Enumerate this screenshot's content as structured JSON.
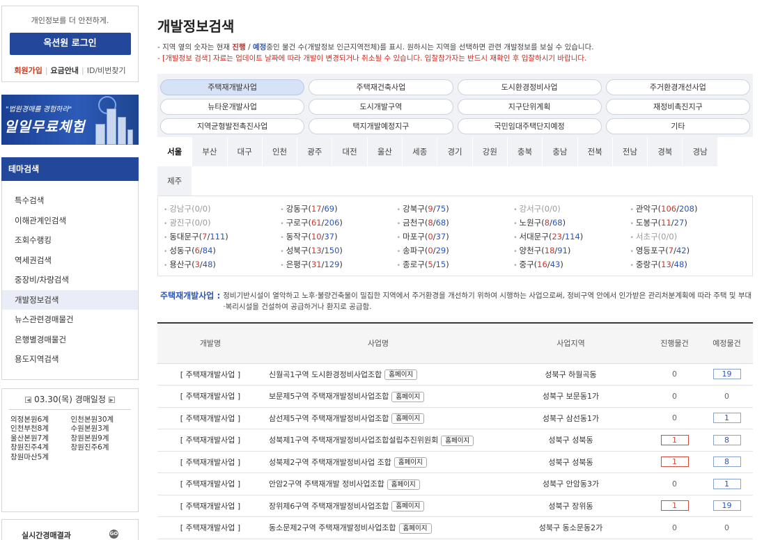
{
  "login": {
    "message": "개인정보를 더 안전하게.",
    "button": "옥션원 로그인",
    "join": "회원가입",
    "pricing": "요금안내",
    "find": "ID/비번찾기"
  },
  "banner": {
    "line1": "\"법원경매를 경험하라\"",
    "line2": "일일무료체험"
  },
  "theme": {
    "title": "테마검색",
    "items": [
      "특수검색",
      "이해관계인검색",
      "조회수랭킹",
      "역세권검색",
      "중장비/차량검색",
      "개발정보검색",
      "뉴스관련경매물건",
      "은행별경매물건",
      "용도지역검색"
    ],
    "active_index": 5
  },
  "schedule": {
    "date": "03.30(목) 경매일정",
    "courts": [
      "의정본원6계",
      "인천본원30계",
      "인천부천8계",
      "수원본원3계",
      "울산본원7계",
      "창원본원9계",
      "창원진주4계",
      "창원진주6계",
      "창원마산5계"
    ]
  },
  "realtime": {
    "label": "실시간경매결과",
    "go": "GO"
  },
  "main": {
    "title": "개발정보검색",
    "desc1_a": "- 지역 옆의 숫자는 현재 ",
    "desc1_prog": "진행",
    "desc1_slash": " / ",
    "desc1_plan": "예정",
    "desc1_b": "중인 물건 수(개발정보 인근지역전체)를 표시. 원하시는 지역을 선택하면 관련 개발정보를 보실 수 있습니다.",
    "desc2": "- [개발정보 검색] 자료는 업데이트 날짜에 따라 개발이 변경되거나 취소될 수 있습니다. 입찰참가자는 반드시 재확인 후 입찰하시기 바랍니다."
  },
  "categories": [
    "주택재개발사업",
    "주택재건축사업",
    "도시환경정비사업",
    "주거환경개선사업",
    "뉴타운개발사업",
    "도시개발구역",
    "지구단위계획",
    "재정비촉진지구",
    "지역균형발전촉진사업",
    "택지개발예정지구",
    "국민임대주택단지예정",
    "기타"
  ],
  "active_category": 0,
  "regions": [
    "서울",
    "부산",
    "대구",
    "인천",
    "광주",
    "대전",
    "울산",
    "세종",
    "경기",
    "강원",
    "충북",
    "충남",
    "전북",
    "전남",
    "경북",
    "경남",
    "제주"
  ],
  "active_region": 0,
  "districts": [
    {
      "name": "강남구",
      "prog": "0",
      "plan": "0",
      "dim": true
    },
    {
      "name": "강동구",
      "prog": "17",
      "plan": "69",
      "dim": false
    },
    {
      "name": "강북구",
      "prog": "9",
      "plan": "75",
      "dim": false
    },
    {
      "name": "강서구",
      "prog": "0",
      "plan": "0",
      "dim": true
    },
    {
      "name": "관악구",
      "prog": "106",
      "plan": "208",
      "dim": false
    },
    {
      "name": "광진구",
      "prog": "0",
      "plan": "0",
      "dim": true
    },
    {
      "name": "구로구",
      "prog": "61",
      "plan": "206",
      "dim": false
    },
    {
      "name": "금천구",
      "prog": "8",
      "plan": "68",
      "dim": false
    },
    {
      "name": "노원구",
      "prog": "8",
      "plan": "68",
      "dim": false
    },
    {
      "name": "도봉구",
      "prog": "11",
      "plan": "27",
      "dim": false
    },
    {
      "name": "동대문구",
      "prog": "7",
      "plan": "111",
      "dim": false
    },
    {
      "name": "동작구",
      "prog": "10",
      "plan": "37",
      "dim": false
    },
    {
      "name": "마포구",
      "prog": "0",
      "plan": "37",
      "dim": false
    },
    {
      "name": "서대문구",
      "prog": "23",
      "plan": "114",
      "dim": false
    },
    {
      "name": "서초구",
      "prog": "0",
      "plan": "0",
      "dim": true
    },
    {
      "name": "성동구",
      "prog": "6",
      "plan": "84",
      "dim": false
    },
    {
      "name": "성북구",
      "prog": "13",
      "plan": "150",
      "dim": false
    },
    {
      "name": "송파구",
      "prog": "0",
      "plan": "29",
      "dim": false
    },
    {
      "name": "양천구",
      "prog": "18",
      "plan": "91",
      "dim": false
    },
    {
      "name": "영등포구",
      "prog": "7",
      "plan": "42",
      "dim": false
    },
    {
      "name": "용산구",
      "prog": "3",
      "plan": "48",
      "dim": false
    },
    {
      "name": "은평구",
      "prog": "31",
      "plan": "129",
      "dim": false
    },
    {
      "name": "종로구",
      "prog": "5",
      "plan": "15",
      "dim": false
    },
    {
      "name": "중구",
      "prog": "16",
      "plan": "43",
      "dim": false
    },
    {
      "name": "중랑구",
      "prog": "13",
      "plan": "48",
      "dim": false
    }
  ],
  "info": {
    "label": "주택재개발사업 :",
    "text": "정비기반시설이 열악하고 노후·불량건축물이 밀집한 지역에서 주거환경을 개선하기 위하여 시행하는 사업으로써, 정비구역 안에서 인가받은 관리처분계획에 따라 주택 및 부대·복리시설을 건설하여 공급하거나 환지로 공급함."
  },
  "table": {
    "headers": [
      "개발명",
      "사업명",
      "사업지역",
      "진행물건",
      "예정물건"
    ],
    "homepage_label": "홈페이지",
    "rows": [
      {
        "type": "[ 주택재개발사업 ]",
        "name": "신월곡1구역 도시환경정비사업조합",
        "area": "성북구 하월곡동",
        "prog": "0",
        "plan": "19"
      },
      {
        "type": "[ 주택재개발사업 ]",
        "name": "보문제5구역 주택재개발정비사업조합",
        "area": "성북구 보문동1가",
        "prog": "0",
        "plan": "0"
      },
      {
        "type": "[ 주택재개발사업 ]",
        "name": "삼선제5구역 주택재개발정비사업조합",
        "area": "성북구 삼선동1가",
        "prog": "0",
        "plan": "1"
      },
      {
        "type": "[ 주택재개발사업 ]",
        "name": "성북제1구역 주택재개발정비사업조합설립추진위원회",
        "area": "성북구 성북동",
        "prog": "1",
        "plan": "8"
      },
      {
        "type": "[ 주택재개발사업 ]",
        "name": "성북제2구역 주택재개발정비사업 조합",
        "area": "성북구 성북동",
        "prog": "1",
        "plan": "8"
      },
      {
        "type": "[ 주택재개발사업 ]",
        "name": "안암2구역 주택재개발 정비사업조합",
        "area": "성북구 안암동3가",
        "prog": "0",
        "plan": "1"
      },
      {
        "type": "[ 주택재개발사업 ]",
        "name": "장위제6구역 주택재개발정비사업조합",
        "area": "성북구 장위동",
        "prog": "1",
        "plan": "19"
      },
      {
        "type": "[ 주택재개발사업 ]",
        "name": "동소문제2구역 주택재개발정비사업조합",
        "area": "성북구 동소문동2가",
        "prog": "0",
        "plan": "0"
      }
    ]
  }
}
